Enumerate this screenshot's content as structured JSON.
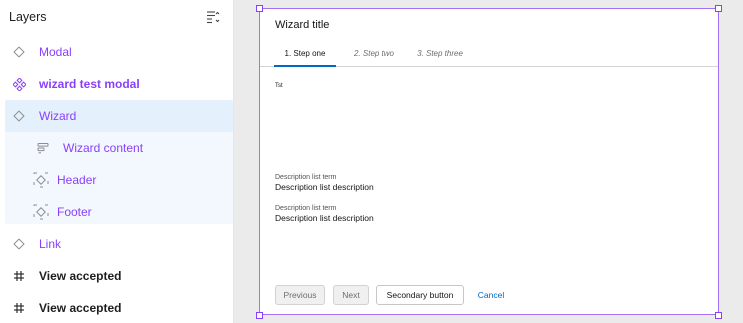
{
  "layers_panel": {
    "title": "Layers",
    "items": [
      {
        "label": "Modal"
      },
      {
        "label": "wizard test modal"
      },
      {
        "label": "Wizard"
      },
      {
        "label": "Wizard content"
      },
      {
        "label": "Header"
      },
      {
        "label": "Footer"
      },
      {
        "label": "Link"
      },
      {
        "label": "View accepted"
      },
      {
        "label": "View accepted"
      }
    ]
  },
  "modal": {
    "title": "Wizard title",
    "tabs": [
      {
        "label": "1. Step one"
      },
      {
        "label": "2. Step two"
      },
      {
        "label": "3. Step three"
      }
    ],
    "body_text": "Tst",
    "description_list": [
      {
        "term": "Description list term",
        "description": "Description list description"
      },
      {
        "term": "Description list term",
        "description": "Description list description"
      }
    ],
    "footer": {
      "previous": "Previous",
      "next": "Next",
      "secondary": "Secondary button",
      "cancel": "Cancel"
    }
  },
  "colors": {
    "accent_purple": "#8a3ffc",
    "selection_blue": "#e5f0fd",
    "link_blue": "#0066cc"
  },
  "icons": {
    "collapse": "collapse-all-icon",
    "instance": "diamond-outline-icon",
    "component": "component-icon",
    "frame": "frame-icon",
    "slot": "dashed-diamond-icon",
    "hash": "hash-icon"
  }
}
